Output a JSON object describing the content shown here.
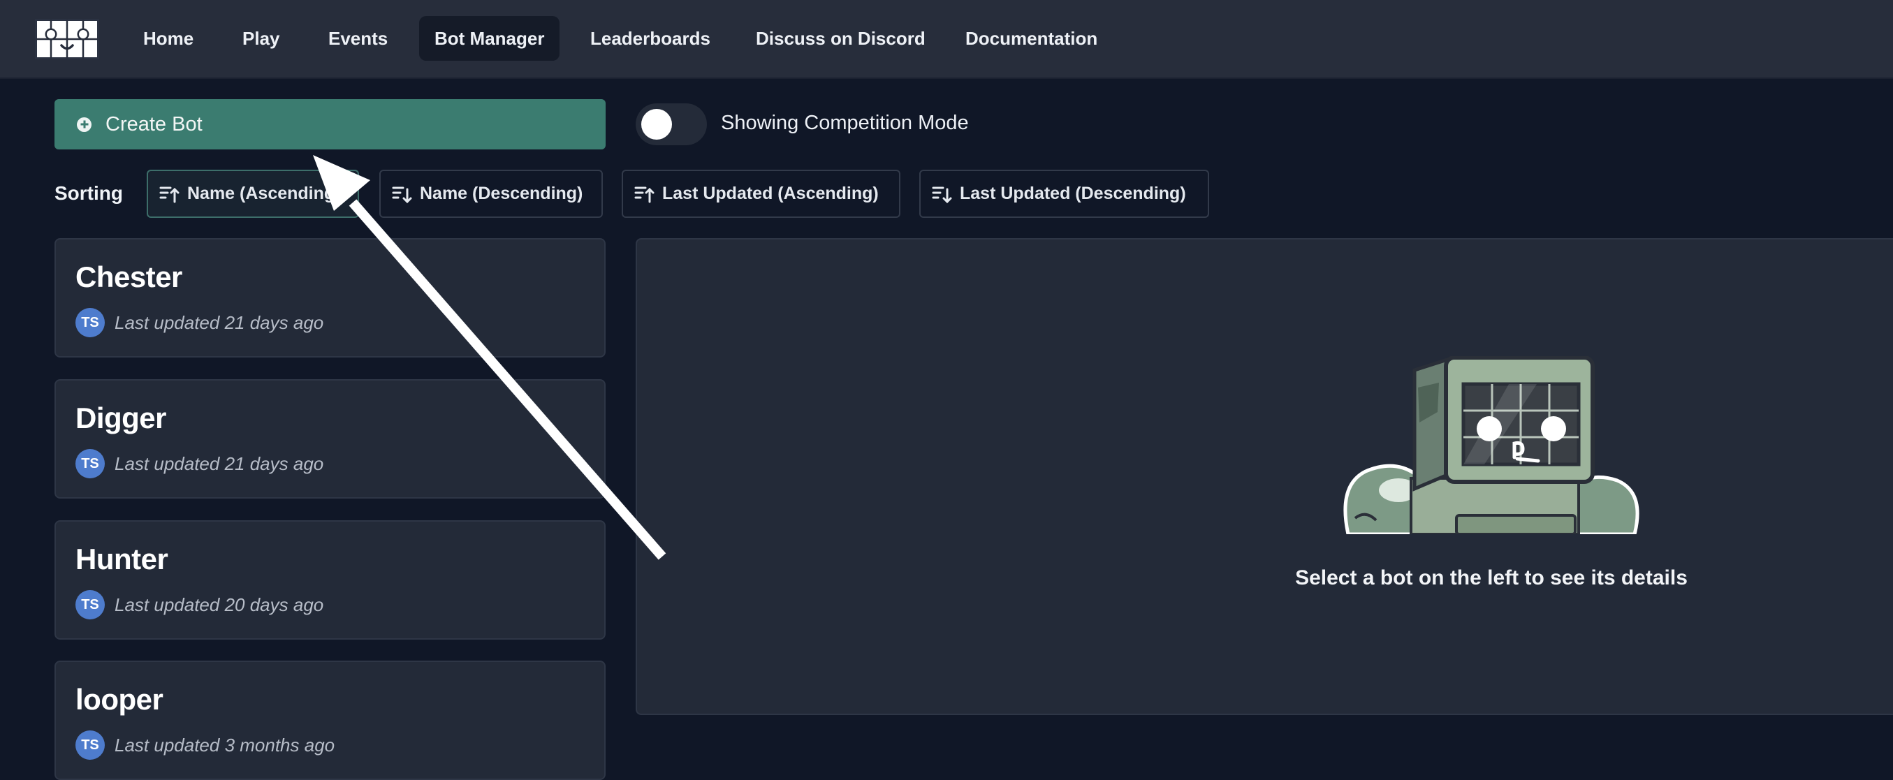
{
  "nav": {
    "items": [
      {
        "label": "Home"
      },
      {
        "label": "Play"
      },
      {
        "label": "Events"
      },
      {
        "label": "Bot Manager",
        "active": true
      },
      {
        "label": "Leaderboards"
      },
      {
        "label": "Discuss on Discord"
      },
      {
        "label": "Documentation"
      }
    ]
  },
  "actions": {
    "create_label": "Create Bot",
    "toggle_on": false,
    "toggle_label": "Showing Competition Mode"
  },
  "sorting": {
    "label": "Sorting",
    "options": [
      {
        "label": "Name (Ascending)",
        "active": true
      },
      {
        "label": "Name (Descending)"
      },
      {
        "label": "Last Updated (Ascending)"
      },
      {
        "label": "Last Updated (Descending)"
      }
    ]
  },
  "bots": [
    {
      "name": "Chester",
      "initials": "TS",
      "updated": "Last updated 21 days ago"
    },
    {
      "name": "Digger",
      "initials": "TS",
      "updated": "Last updated 21 days ago"
    },
    {
      "name": "Hunter",
      "initials": "TS",
      "updated": "Last updated 20 days ago"
    },
    {
      "name": "looper",
      "initials": "TS",
      "updated": "Last updated 3 months ago"
    }
  ],
  "details": {
    "empty_text": "Select a bot on the left to see its details"
  },
  "colors": {
    "background": "#101727",
    "navbar": "#272d3b",
    "accent": "#3b7c70",
    "card": "#232a38",
    "avatar": "#4e7ccd"
  }
}
